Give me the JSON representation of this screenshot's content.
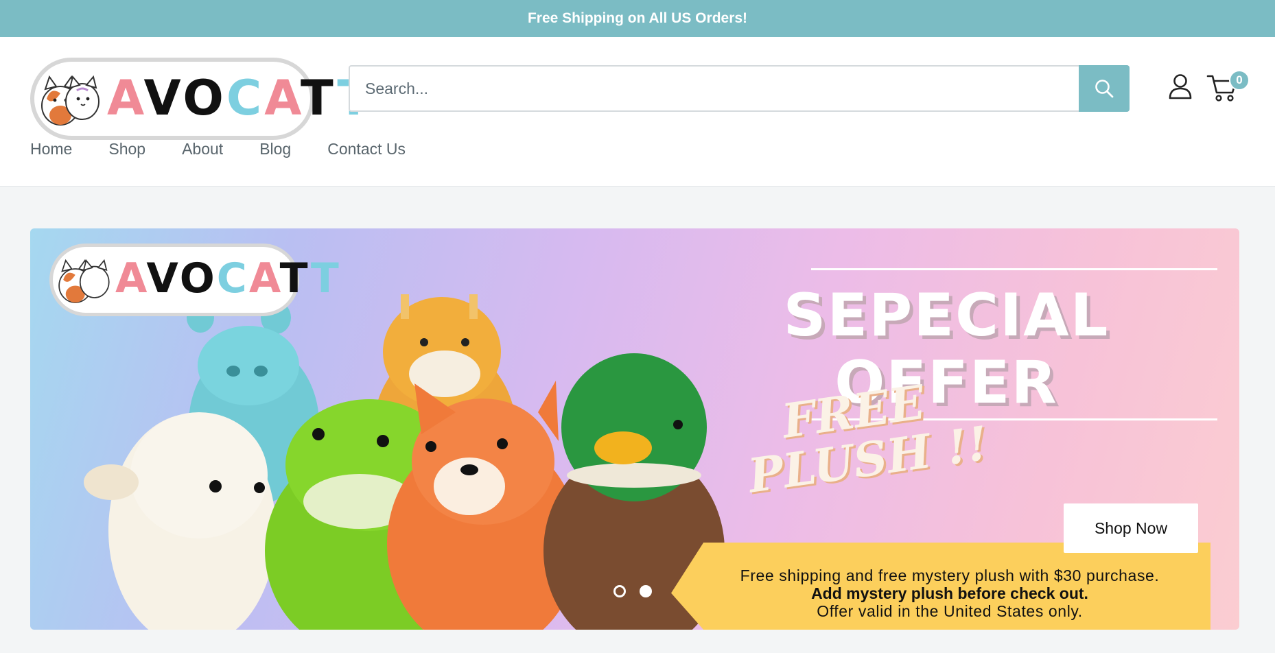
{
  "announcement": {
    "text": "Free Shipping on All US Orders!"
  },
  "brand": {
    "name": "AVOCATT",
    "letters": [
      "A",
      "V",
      "O",
      "C",
      "A",
      "T",
      "T"
    ],
    "letter_colors": [
      "#f08a96",
      "#111111",
      "#111111",
      "#7dcfe0",
      "#f08a96",
      "#111111",
      "#7dcfe0"
    ]
  },
  "search": {
    "placeholder": "Search..."
  },
  "cart": {
    "count": "0"
  },
  "nav": {
    "items": [
      "Home",
      "Shop",
      "About",
      "Blog",
      "Contact Us"
    ]
  },
  "hero": {
    "title_line1": "SEPECIAL",
    "title_line2": "OFFER",
    "promo_line1": "FREE",
    "promo_line2": "PLUSH !!",
    "button_label": "Shop Now",
    "details_line1": "Free shipping and free mystery plush with $30 purchase.",
    "details_line2": "Add mystery plush before check out.",
    "details_line3": "Offer valid in the United States only.",
    "slides": 2,
    "active_slide": 1
  },
  "colors": {
    "accent": "#7bbcc4",
    "promo_banner": "#fccf5c",
    "text": "#59656c"
  },
  "icons": [
    "search-icon",
    "account-icon",
    "cart-icon"
  ]
}
